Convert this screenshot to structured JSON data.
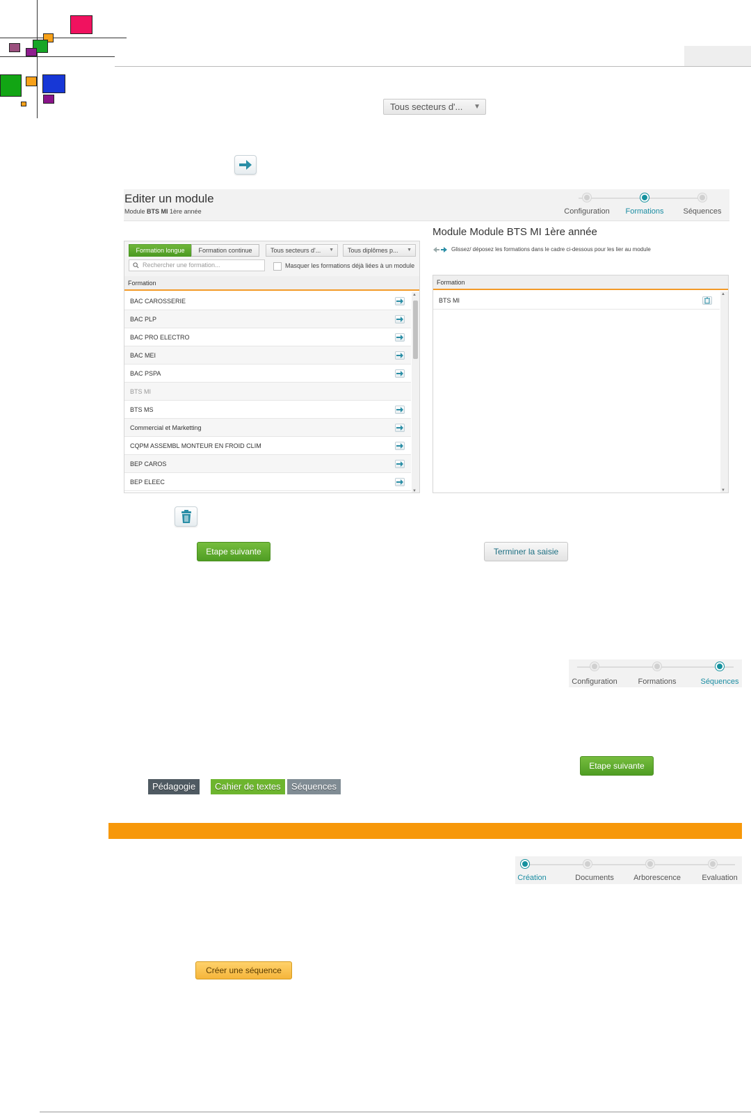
{
  "header": {
    "sector_select": "Tous secteurs d'..."
  },
  "editor": {
    "title": "Editer un module",
    "subtitle_prefix": "Module ",
    "subtitle_bold": "BTS MI",
    "subtitle_suffix": " 1ère année",
    "steps": [
      {
        "label": "Configuration",
        "active": false
      },
      {
        "label": "Formations",
        "active": true
      },
      {
        "label": "Séquences",
        "active": false
      }
    ]
  },
  "left_panel": {
    "tab_long": "Formation longue",
    "tab_continue": "Formation continue",
    "sector_filter": "Tous secteurs d'...",
    "diploma_filter": "Tous diplômes p...",
    "search_placeholder": "Rechercher une formation...",
    "hide_linked_label": "Masquer les formations déjà liées à un module",
    "column_header": "Formation",
    "rows": [
      {
        "label": "BAC CAROSSERIE",
        "linked": false
      },
      {
        "label": "BAC PLP",
        "linked": false
      },
      {
        "label": "BAC PRO ELECTRO",
        "linked": false
      },
      {
        "label": "BAC MEI",
        "linked": false
      },
      {
        "label": "BAC PSPA",
        "linked": false
      },
      {
        "label": "BTS MI",
        "linked": true
      },
      {
        "label": "BTS MS",
        "linked": false
      },
      {
        "label": "Commercial et Marketting",
        "linked": false
      },
      {
        "label": "CQPM ASSEMBL MONTEUR EN FROID CLIM",
        "linked": false
      },
      {
        "label": "BEP CAROS",
        "linked": false
      },
      {
        "label": "BEP ELEEC",
        "linked": false
      }
    ]
  },
  "right_panel": {
    "title": "Module Module BTS MI 1ère année",
    "hint": "Glissez/ déposez les formations dans le cadre ci-dessous pour les lier au module",
    "column_header": "Formation",
    "rows": [
      {
        "label": "BTS MI"
      }
    ]
  },
  "actions": {
    "next_step": "Etape suivante",
    "finish": "Terminer la saisie"
  },
  "steps_sequences": [
    {
      "label": "Configuration",
      "active": false
    },
    {
      "label": "Formations",
      "active": false
    },
    {
      "label": "Séquences",
      "active": true
    }
  ],
  "next_step_2": "Etape suivante",
  "tags": {
    "pedagogie": "Pédagogie",
    "cahier": "Cahier de textes",
    "sequences": "Séquences"
  },
  "steps_creation": [
    {
      "label": "Création",
      "active": true
    },
    {
      "label": "Documents",
      "active": false
    },
    {
      "label": "Arborescence",
      "active": false
    },
    {
      "label": "Evaluation",
      "active": false
    }
  ],
  "create_sequence": "Créer une séquence",
  "colors": {
    "accent_teal": "#15919e",
    "green": "#5aa72c",
    "orange": "#f7980a"
  }
}
